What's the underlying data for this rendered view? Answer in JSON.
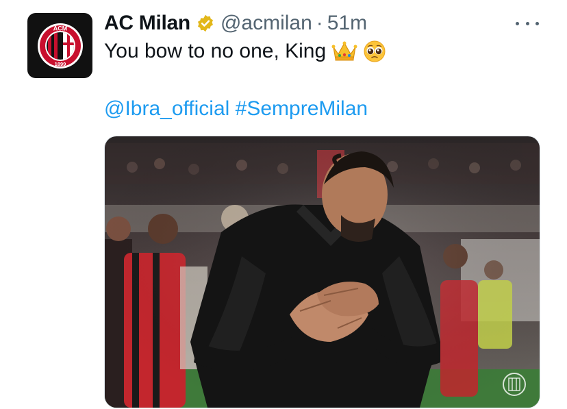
{
  "tweet": {
    "author_name": "AC Milan",
    "handle": "@acmilan",
    "separator": "·",
    "time": "51m",
    "text": "You bow to no one, King",
    "mention": "@Ibra_official",
    "hashtag": "#SempreMilan"
  },
  "avatar": {
    "top_text": "ACM",
    "year": "1899"
  },
  "icons": {
    "verified": "verified-badge-icon",
    "more": "more-options-icon",
    "emoji_1": "crown-emoji",
    "emoji_2": "pleading-face-emoji"
  },
  "colors": {
    "name": "#0f1419",
    "muted": "#536471",
    "link": "#1d9bf0",
    "verified_gold": "#e2b719",
    "milan_red": "#c8102e"
  }
}
